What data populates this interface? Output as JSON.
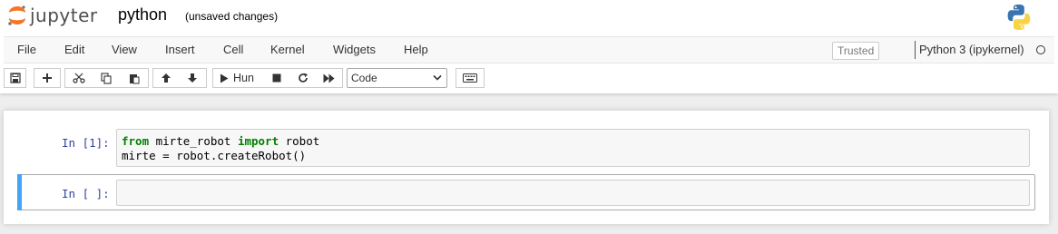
{
  "app": {
    "logo_text": "jupyter",
    "notebook_name": "python",
    "save_status": "(unsaved changes)"
  },
  "menubar": {
    "items": [
      "File",
      "Edit",
      "View",
      "Insert",
      "Cell",
      "Kernel",
      "Widgets",
      "Help"
    ],
    "trusted": "Trusted",
    "kernel_name": "Python 3 (ipykernel)"
  },
  "toolbar": {
    "icons": [
      "save-icon",
      "plus-icon",
      "cut-icon",
      "copy-icon",
      "paste-icon",
      "arrow-up-icon",
      "arrow-down-icon",
      "play-icon",
      "stop-icon",
      "restart-icon",
      "fast-forward-icon",
      "keyboard-icon"
    ],
    "run_label": "Hun",
    "cell_type": "Code"
  },
  "cells": [
    {
      "prompt": "In [1]:",
      "lines": [
        {
          "kw1": "from",
          "mid": " mirte_robot ",
          "kw2": "import",
          "tail": " robot"
        },
        {
          "text": "mirte = robot.createRobot()"
        }
      ]
    },
    {
      "prompt": "In [ ]:"
    }
  ],
  "colors": {
    "prompt": "#303f9f",
    "keyword": "#008000",
    "selection": "#42a5f5"
  }
}
